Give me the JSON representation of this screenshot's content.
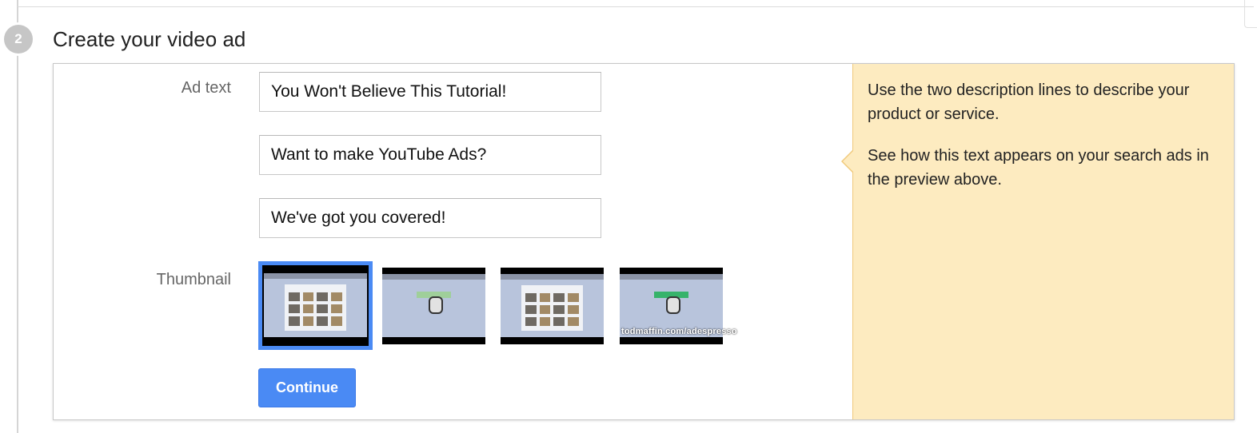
{
  "step": {
    "number": "2",
    "title": "Create your video ad"
  },
  "form": {
    "ad_text_label": "Ad text",
    "lines": [
      "You Won't Believe This Tutorial!",
      "Want to make YouTube Ads?",
      "We've got you covered!"
    ],
    "thumbnail_label": "Thumbnail",
    "thumbnails": [
      {
        "name": "thumbnail-1",
        "selected": true
      },
      {
        "name": "thumbnail-2",
        "selected": false
      },
      {
        "name": "thumbnail-3",
        "selected": false
      },
      {
        "name": "thumbnail-4",
        "selected": false,
        "watermark": "todmaffin.com/adespresso"
      }
    ],
    "continue_label": "Continue"
  },
  "help": {
    "paragraphs": [
      "Use the two description lines to describe your product or service.",
      "See how this text appears on your search ads in the preview above."
    ]
  },
  "colors": {
    "accent": "#4a8af4",
    "help_background": "#fdebc0",
    "help_border": "#f0c97a"
  }
}
